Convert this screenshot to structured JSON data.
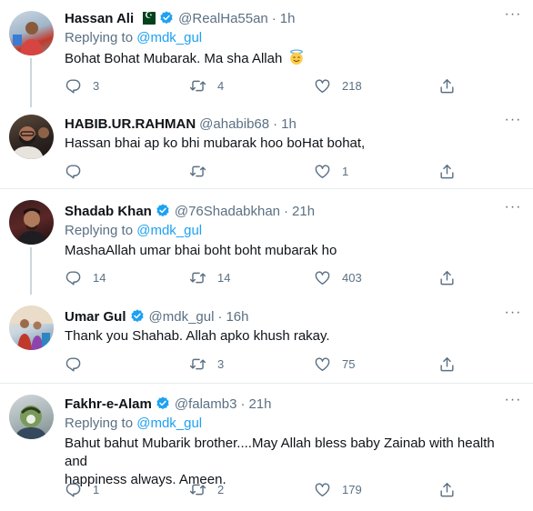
{
  "colors": {
    "accent": "#1da1f2",
    "secondary_text": "#5b7083",
    "divider": "#e6ecf0"
  },
  "tweets": [
    {
      "name": "Hassan Ali",
      "handle": "@RealHa55an",
      "dot": "·",
      "time": "1h",
      "verified": true,
      "flag": "pakistan-flag-icon",
      "replying_prefix": "Replying to",
      "replying_to": "@mdk_gul",
      "text": "Bohat Bohat Mubarak. Ma sha Allah",
      "emoji": "smiling-face-with-halo-icon",
      "replies": "3",
      "retweets": "4",
      "likes": "218"
    },
    {
      "name": "HABIB.UR.RAHMAN",
      "handle": "@ahabib68",
      "dot": "·",
      "time": "1h",
      "verified": false,
      "text": "Hassan bhai ap ko bhi mubarak hoo boHat bohat,",
      "replies": "",
      "retweets": "",
      "likes": "1"
    },
    {
      "name": "Shadab Khan",
      "handle": "@76Shadabkhan",
      "dot": "·",
      "time": "21h",
      "verified": true,
      "replying_prefix": "Replying to",
      "replying_to": "@mdk_gul",
      "text": "MashaAllah umar bhai boht boht mubarak ho",
      "replies": "14",
      "retweets": "14",
      "likes": "403"
    },
    {
      "name": "Umar Gul",
      "handle": "@mdk_gul",
      "dot": "·",
      "time": "16h",
      "verified": true,
      "text": "Thank you Shahab. Allah apko khush rakay.",
      "replies": "",
      "retweets": "3",
      "likes": "75"
    },
    {
      "name": "Fakhr-e-Alam",
      "handle": "@falamb3",
      "dot": "·",
      "time": "21h",
      "verified": true,
      "replying_prefix": "Replying to",
      "replying_to": "@mdk_gul",
      "text_line1": "Bahut bahut Mubarik brother....May Allah bless baby Zainab with health and",
      "text_line2": "happiness always. Ameen.",
      "replies": "1",
      "retweets": "2",
      "likes": "179"
    }
  ]
}
